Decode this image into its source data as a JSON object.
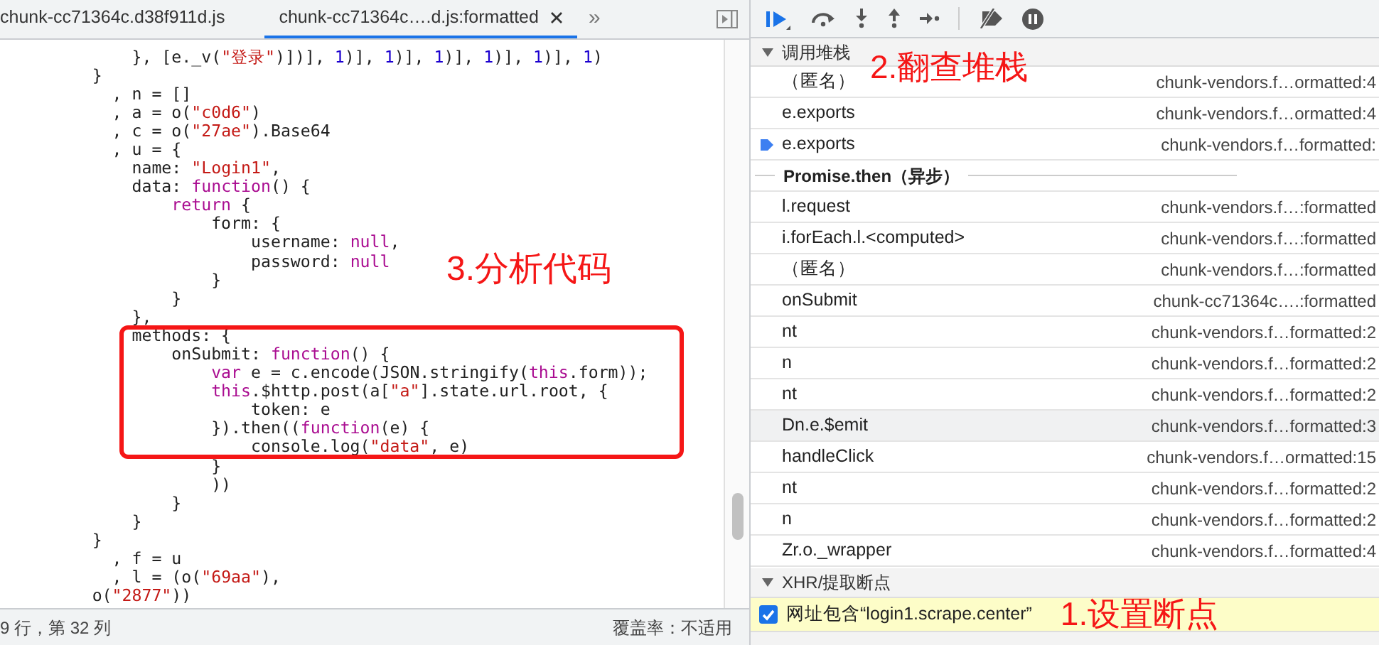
{
  "editor": {
    "tabs": [
      {
        "label": "chunk-cc71364c.d38f911d.js",
        "selected": false,
        "closable": false
      },
      {
        "label": "chunk-cc71364c….d.js:formatted",
        "selected": true,
        "closable": true
      }
    ],
    "more_tabs": "»",
    "code_lines": [
      [
        {
          "kind": "plain",
          "text": "             }, [e._v("
        },
        {
          "kind": "string",
          "text": "\"登录\""
        },
        {
          "kind": "plain",
          "text": ")])], "
        },
        {
          "kind": "number",
          "text": "1"
        },
        {
          "kind": "plain",
          "text": ")], "
        },
        {
          "kind": "number",
          "text": "1"
        },
        {
          "kind": "plain",
          "text": ")], "
        },
        {
          "kind": "number",
          "text": "1"
        },
        {
          "kind": "plain",
          "text": ")], "
        },
        {
          "kind": "number",
          "text": "1"
        },
        {
          "kind": "plain",
          "text": ")], "
        },
        {
          "kind": "number",
          "text": "1"
        },
        {
          "kind": "plain",
          "text": ")], "
        },
        {
          "kind": "number",
          "text": "1"
        },
        {
          "kind": "plain",
          "text": ")"
        }
      ],
      [
        {
          "kind": "plain",
          "text": "         }"
        }
      ],
      [
        {
          "kind": "plain",
          "text": "           , n = []"
        }
      ],
      [
        {
          "kind": "plain",
          "text": "           , a = o("
        },
        {
          "kind": "string",
          "text": "\"c0d6\""
        },
        {
          "kind": "plain",
          "text": ")"
        }
      ],
      [
        {
          "kind": "plain",
          "text": "           , c = o("
        },
        {
          "kind": "string",
          "text": "\"27ae\""
        },
        {
          "kind": "plain",
          "text": ").Base64"
        }
      ],
      [
        {
          "kind": "plain",
          "text": "           , u = {"
        }
      ],
      [
        {
          "kind": "plain",
          "text": "             name: "
        },
        {
          "kind": "string",
          "text": "\"Login1\""
        },
        {
          "kind": "plain",
          "text": ","
        }
      ],
      [
        {
          "kind": "plain",
          "text": "             data: "
        },
        {
          "kind": "keyword",
          "text": "function"
        },
        {
          "kind": "plain",
          "text": "() {"
        }
      ],
      [
        {
          "kind": "keyword",
          "text": "                 return"
        },
        {
          "kind": "plain",
          "text": " {"
        }
      ],
      [
        {
          "kind": "plain",
          "text": "                     form: {"
        }
      ],
      [
        {
          "kind": "plain",
          "text": "                         username: "
        },
        {
          "kind": "keyword",
          "text": "null"
        },
        {
          "kind": "plain",
          "text": ","
        }
      ],
      [
        {
          "kind": "plain",
          "text": "                         password: "
        },
        {
          "kind": "keyword",
          "text": "null"
        }
      ],
      [
        {
          "kind": "plain",
          "text": "                     }"
        }
      ],
      [
        {
          "kind": "plain",
          "text": "                 }"
        }
      ],
      [
        {
          "kind": "plain",
          "text": "             },"
        }
      ],
      [
        {
          "kind": "plain",
          "text": "             methods: {"
        }
      ],
      [
        {
          "kind": "plain",
          "text": "                 onSubmit: "
        },
        {
          "kind": "keyword",
          "text": "function"
        },
        {
          "kind": "plain",
          "text": "() {"
        }
      ],
      [
        {
          "kind": "keyword",
          "text": "                     var"
        },
        {
          "kind": "plain",
          "text": " e = c.encode(JSON.stringify("
        },
        {
          "kind": "keyword",
          "text": "this"
        },
        {
          "kind": "plain",
          "text": ".form));"
        }
      ],
      [
        {
          "kind": "keyword",
          "text": "                     this"
        },
        {
          "kind": "plain",
          "text": ".$http.post(a["
        },
        {
          "kind": "string",
          "text": "\"a\""
        },
        {
          "kind": "plain",
          "text": "].state.url.root, {"
        }
      ],
      [
        {
          "kind": "plain",
          "text": "                         token: e"
        }
      ],
      [
        {
          "kind": "plain",
          "text": "                     }).then(("
        },
        {
          "kind": "keyword",
          "text": "function"
        },
        {
          "kind": "plain",
          "text": "(e) {"
        }
      ],
      [
        {
          "kind": "plain",
          "text": "                         console.log("
        },
        {
          "kind": "string",
          "text": "\"data\""
        },
        {
          "kind": "plain",
          "text": ", e)"
        }
      ],
      [
        {
          "kind": "plain",
          "text": "                     }"
        }
      ],
      [
        {
          "kind": "plain",
          "text": "                     ))"
        }
      ],
      [
        {
          "kind": "plain",
          "text": "                 }"
        }
      ],
      [
        {
          "kind": "plain",
          "text": "             }"
        }
      ],
      [
        {
          "kind": "plain",
          "text": "         }"
        }
      ],
      [
        {
          "kind": "plain",
          "text": "           , f = u"
        }
      ],
      [
        {
          "kind": "plain",
          "text": "           , l = (o("
        },
        {
          "kind": "string",
          "text": "\"69aa\""
        },
        {
          "kind": "plain",
          "text": "),"
        }
      ],
      [
        {
          "kind": "plain",
          "text": "         o("
        },
        {
          "kind": "string",
          "text": "\"2877\""
        },
        {
          "kind": "plain",
          "text": "))"
        }
      ]
    ],
    "annotation": "3.分析代码",
    "status_position": "9 行，第 32 列",
    "status_coverage": "覆盖率：不适用"
  },
  "debugger": {
    "call_stack": {
      "title": "调用堆栈",
      "expanded": true,
      "annotation": "2.翻查堆栈",
      "frames": [
        {
          "kind": "frame",
          "name": "（匿名）",
          "location": "chunk-vendors.f…ormatted:4",
          "selected": false,
          "highlighted": false
        },
        {
          "kind": "frame",
          "name": "e.exports",
          "location": "chunk-vendors.f…ormatted:4",
          "selected": false,
          "highlighted": false
        },
        {
          "kind": "frame",
          "name": "e.exports",
          "location": "chunk-vendors.f…formatted:",
          "selected": true,
          "highlighted": false
        },
        {
          "kind": "async",
          "name": "Promise.then（异步）"
        },
        {
          "kind": "frame",
          "name": "l.request",
          "location": "chunk-vendors.f…:formatted",
          "selected": false,
          "highlighted": false
        },
        {
          "kind": "frame",
          "name": "i.forEach.l.<computed>",
          "location": "chunk-vendors.f…:formatted",
          "selected": false,
          "highlighted": false
        },
        {
          "kind": "frame",
          "name": "（匿名）",
          "location": "chunk-vendors.f…:formatted",
          "selected": false,
          "highlighted": false
        },
        {
          "kind": "frame",
          "name": "onSubmit",
          "location": "chunk-cc71364c….:formatted",
          "selected": false,
          "highlighted": false
        },
        {
          "kind": "frame",
          "name": "nt",
          "location": "chunk-vendors.f…formatted:2",
          "selected": false,
          "highlighted": false
        },
        {
          "kind": "frame",
          "name": "n",
          "location": "chunk-vendors.f…formatted:2",
          "selected": false,
          "highlighted": false
        },
        {
          "kind": "frame",
          "name": "nt",
          "location": "chunk-vendors.f…formatted:2",
          "selected": false,
          "highlighted": false
        },
        {
          "kind": "frame",
          "name": "Dn.e.$emit",
          "location": "chunk-vendors.f…formatted:3",
          "selected": false,
          "highlighted": true
        },
        {
          "kind": "frame",
          "name": "handleClick",
          "location": "chunk-vendors.f…ormatted:15",
          "selected": false,
          "highlighted": false
        },
        {
          "kind": "frame",
          "name": "nt",
          "location": "chunk-vendors.f…formatted:2",
          "selected": false,
          "highlighted": false
        },
        {
          "kind": "frame",
          "name": "n",
          "location": "chunk-vendors.f…formatted:2",
          "selected": false,
          "highlighted": false
        },
        {
          "kind": "frame",
          "name": "Zr.o._wrapper",
          "location": "chunk-vendors.f…formatted:4",
          "selected": false,
          "highlighted": false
        }
      ]
    },
    "xhr_breakpoints": {
      "title": "XHR/提取断点",
      "expanded": true,
      "annotation": "1.设置断点",
      "items": [
        {
          "label": "网址包含“login1.scrape.center”",
          "checked": true
        }
      ]
    }
  }
}
